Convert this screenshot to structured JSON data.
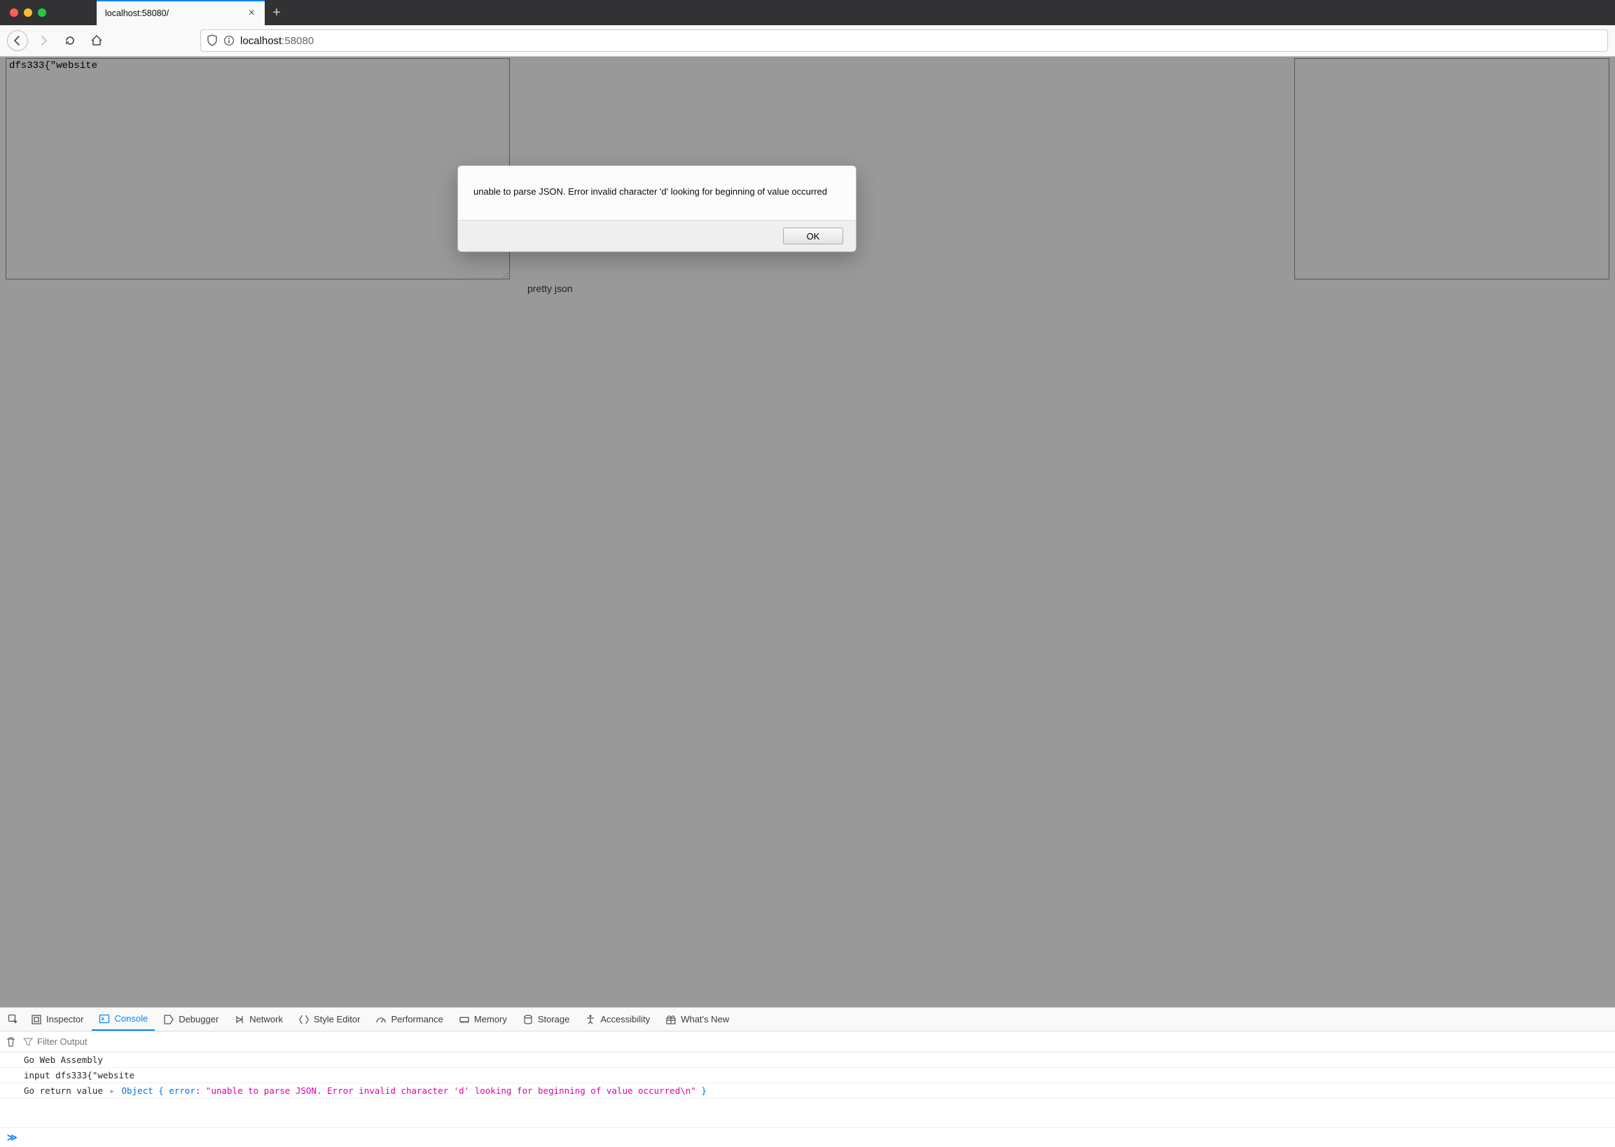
{
  "window": {
    "tab_title": "localhost:58080/",
    "url_host": "localhost",
    "url_port": ":58080"
  },
  "page": {
    "textarea_value": "dfs333{\"website",
    "button_label": "pretty json"
  },
  "alert": {
    "message": "unable to parse JSON. Error invalid character 'd' looking for beginning of value occurred",
    "ok_label": "OK"
  },
  "devtools": {
    "tabs": {
      "inspector": "Inspector",
      "console": "Console",
      "debugger": "Debugger",
      "network": "Network",
      "style_editor": "Style Editor",
      "performance": "Performance",
      "memory": "Memory",
      "storage": "Storage",
      "accessibility": "Accessibility",
      "whats_new": "What's New"
    },
    "filter_placeholder": "Filter Output",
    "log": {
      "l1": "Go Web Assembly",
      "l2": "input dfs333{\"website",
      "l3_prefix": "Go return value ",
      "l3_obj": "Object",
      "l3_open": " { ",
      "l3_key": "error",
      "l3_colon": ": ",
      "l3_str": "\"unable to parse JSON. Error invalid character 'd' looking for beginning of value occurred\\n\"",
      "l3_close": " }"
    },
    "prompt": "≫"
  }
}
